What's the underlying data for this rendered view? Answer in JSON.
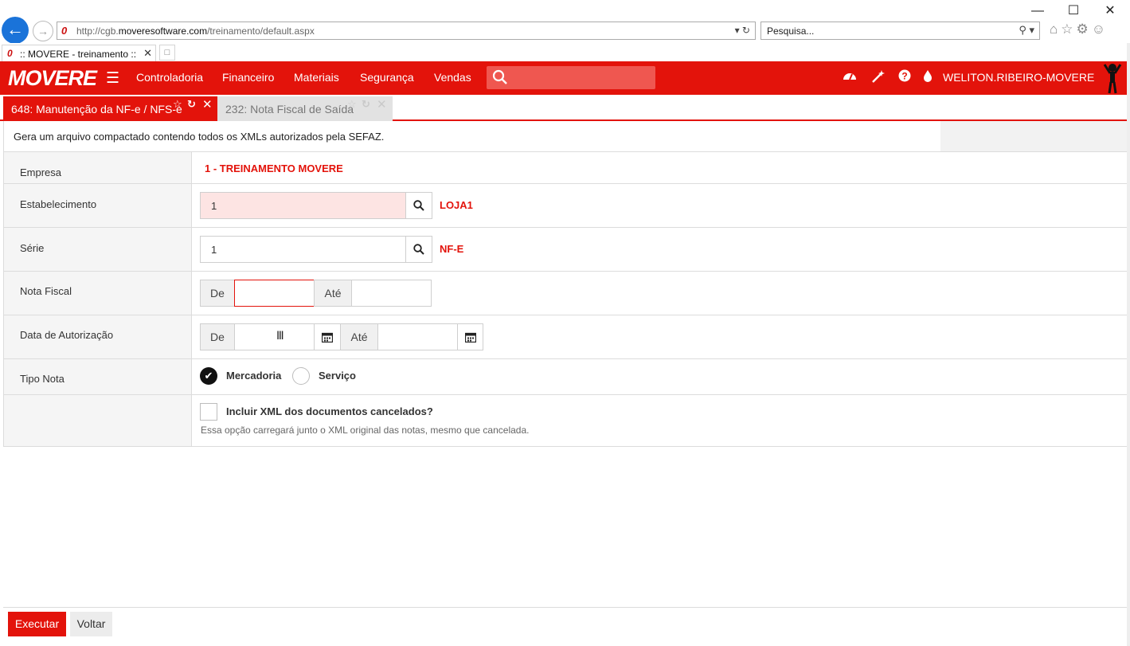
{
  "browser": {
    "url_prefix": "http://cgb.",
    "url_domain": "moveresoftware.com",
    "url_path": "/treinamento/default.aspx",
    "search_placeholder": "Pesquisa...",
    "tab_title": ":: MOVERE - treinamento ::"
  },
  "header": {
    "logo": "MOVERE",
    "nav": [
      "Controladoria",
      "Financeiro",
      "Materiais",
      "Segurança",
      "Vendas"
    ],
    "search_value": "",
    "user": "WELITON.RIBEIRO-MOVERE"
  },
  "tabs": [
    {
      "label": "648: Manutenção da NF-e / NFS-e",
      "active": true
    },
    {
      "label": "232: Nota Fiscal de Saída",
      "active": false
    }
  ],
  "form": {
    "description": "Gera um arquivo compactado contendo todos os XMLs autorizados pela SEFAZ.",
    "empresa": {
      "label": "Empresa",
      "value": "1 - TREINAMENTO MOVERE"
    },
    "estabelecimento": {
      "label": "Estabelecimento",
      "code": "1",
      "name": "LOJA1"
    },
    "serie": {
      "label": "Série",
      "code": "1",
      "name": "NF-E"
    },
    "nota_fiscal": {
      "label": "Nota Fiscal",
      "from_label": "De",
      "to_label": "Até",
      "from": "",
      "to": ""
    },
    "data_autorizacao": {
      "label": "Data de Autorização",
      "from_label": "De",
      "to_label": "Até",
      "from": "",
      "to": ""
    },
    "tipo_nota": {
      "label": "Tipo Nota",
      "options": [
        "Mercadoria",
        "Serviço"
      ],
      "selected": "Mercadoria"
    },
    "incluir_cancelados": {
      "label": "Incluir XML dos documentos cancelados?",
      "checked": false,
      "hint": "Essa opção carregará junto o XML original das notas, mesmo que cancelada."
    }
  },
  "footer": {
    "execute": "Executar",
    "back": "Voltar"
  },
  "colors": {
    "brand": "#e3130b",
    "search_bg": "#ef5750"
  }
}
